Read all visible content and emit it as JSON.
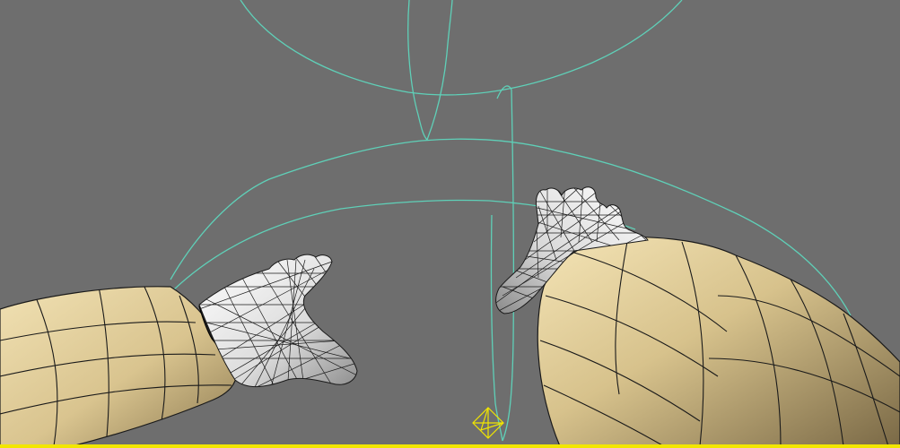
{
  "viewport": {
    "background_color": "#6e6e6e",
    "gizmo_color": "#5fd0b8",
    "selection_color": "#f2e600",
    "wire_color": "#1a1a1a",
    "skin_light": "#ffffff",
    "skin_shadow": "#8a8a8a",
    "sleeve_light": "#e9d7a6",
    "sleeve_shadow": "#6e5d3d",
    "cuff_color": "#1d1d1d"
  },
  "objects": {
    "left_arm_icon": "sleeved-arm-icon",
    "left_hand_icon": "wireframe-hand-icon",
    "right_arm_icon": "sleeved-arm-icon",
    "right_hand_icon": "wireframe-hand-icon",
    "pivot_icon": "diamond-gizmo-icon",
    "rig_icon": "circular-rig-gizmo-icon"
  }
}
